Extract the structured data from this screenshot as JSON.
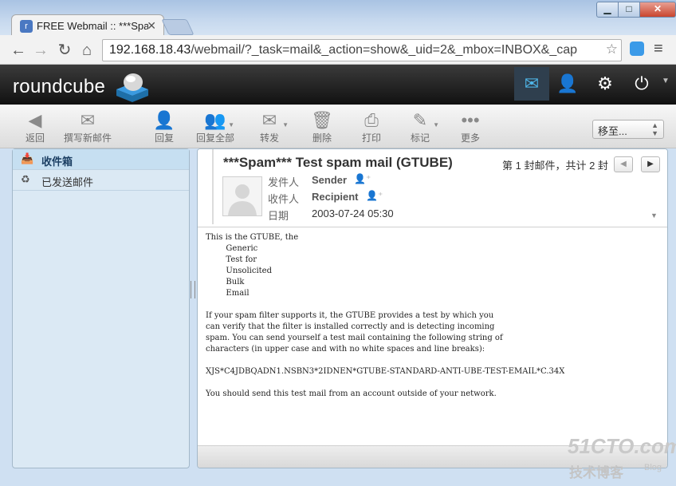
{
  "browser": {
    "tab_title": "FREE Webmail :: ***Spam",
    "favicon": "roundcube-favicon",
    "url_host": "192.168.18.43",
    "url_path": "/webmail/?_task=mail&_action=show&_uid=2&_mbox=INBOX&_cap",
    "window": {
      "min": "▁",
      "max": "□",
      "close": "✕"
    }
  },
  "app": {
    "logo": "roundcube",
    "top_icons": [
      "mail-icon",
      "contacts-icon",
      "settings-icon",
      "logout-icon"
    ]
  },
  "toolbar": {
    "back": "返回",
    "compose": "撰写新邮件",
    "reply": "回复",
    "reply_all": "回复全部",
    "forward": "转发",
    "delete": "删除",
    "print": "打印",
    "mark": "标记",
    "more": "更多",
    "move_to": "移至..."
  },
  "folders": {
    "inbox": "收件箱",
    "sent": "已发送邮件"
  },
  "message": {
    "subject": "***Spam*** Test spam mail (GTUBE)",
    "counter": "第 1 封邮件，共计 2 封",
    "from_label": "发件人",
    "from": "Sender",
    "to_label": "收件人",
    "to": "Recipient",
    "date_label": "日期",
    "date": "2003-07-24 05:30",
    "body": "This is the GTUBE, the\n        Generic\n        Test for\n        Unsolicited\n        Bulk\n        Email\n\nIf your spam filter supports it, the GTUBE provides a test by which you\ncan verify that the filter is installed correctly and is detecting incoming\nspam. You can send yourself a test mail containing the following string of\ncharacters (in upper case and with no white spaces and line breaks):\n\nXJS*C4JDBQADN1.NSBN3*2IDNEN*GTUBE-STANDARD-ANTI-UBE-TEST-EMAIL*C.34X\n\nYou should send this test mail from an account outside of your network."
  },
  "watermark": {
    "line1": "51CTO.com",
    "line2": "技术博客",
    "line3": "Blog"
  },
  "colors": {
    "header_bg": "#1f1f1f",
    "accent": "#4fb7ea",
    "sidebar_bg": "#dbe9f4",
    "selected_folder": "#c6dff1"
  }
}
